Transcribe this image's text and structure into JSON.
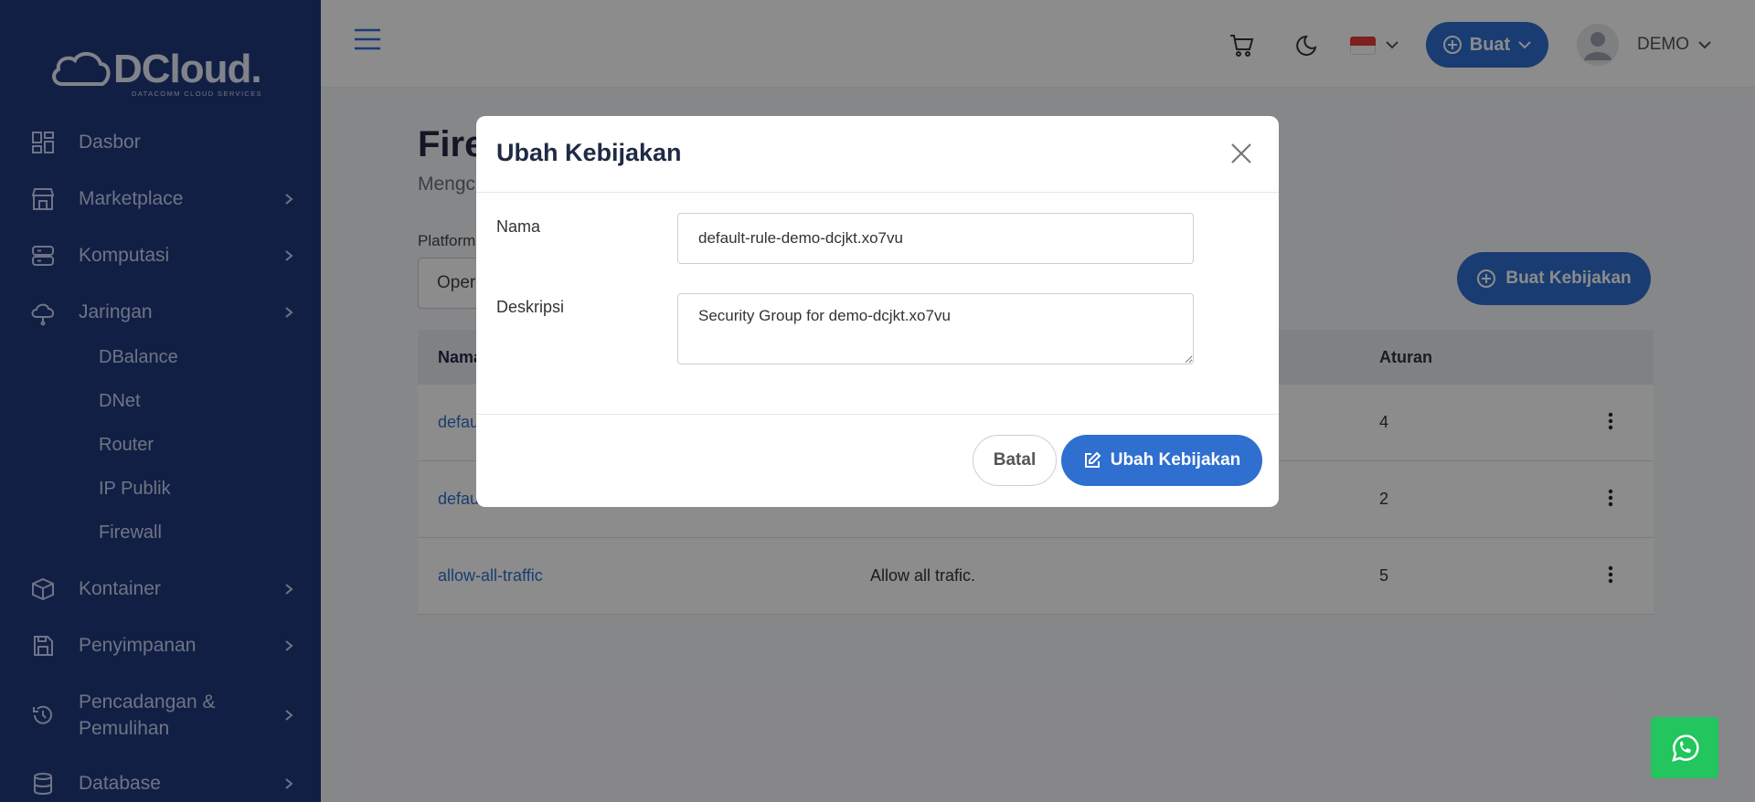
{
  "brand": {
    "name": "DCloud.",
    "tagline": "DATACOMM CLOUD SERVICES"
  },
  "sidebar": {
    "items": [
      {
        "label": "Dasbor",
        "icon": "dashboard-icon"
      },
      {
        "label": "Marketplace",
        "icon": "store-icon"
      },
      {
        "label": "Komputasi",
        "icon": "server-icon"
      },
      {
        "label": "Jaringan",
        "icon": "cloud-network-icon"
      },
      {
        "label": "Kontainer",
        "icon": "box-icon"
      },
      {
        "label": "Penyimpanan",
        "icon": "storage-icon"
      },
      {
        "label": "Pencadangan &",
        "label2": "Pemulihan",
        "icon": "history-icon"
      },
      {
        "label": "Database",
        "icon": "database-icon"
      }
    ],
    "sub_items": [
      "DBalance",
      "DNet",
      "Router",
      "IP Publik",
      "Firewall"
    ]
  },
  "topbar": {
    "create_label": "Buat",
    "user_name": "DEMO"
  },
  "page": {
    "title": "Fire",
    "subtitle": "Mengc",
    "platform_label": "Platform",
    "platform_value": "Oper",
    "create_policy_label": "Buat Kebijakan"
  },
  "table": {
    "headers": [
      "Nama",
      "Aturan"
    ],
    "rows": [
      {
        "name": "defau",
        "description": "",
        "rules": "4"
      },
      {
        "name": "defau",
        "description": "",
        "rules": "2"
      },
      {
        "name": "allow-all-traffic",
        "description": "Allow all trafic.",
        "rules": "5"
      }
    ]
  },
  "modal": {
    "title": "Ubah Kebijakan",
    "name_label": "Nama",
    "name_value": "default-rule-demo-dcjkt.xo7vu",
    "desc_label": "Deskripsi",
    "desc_value": "Security Group for demo-dcjkt.xo7vu",
    "cancel_label": "Batal",
    "submit_label": "Ubah Kebijakan"
  },
  "colors": {
    "sidebar": "#213a7e",
    "accent": "#2f6fcf",
    "whatsapp": "#22c55e"
  }
}
